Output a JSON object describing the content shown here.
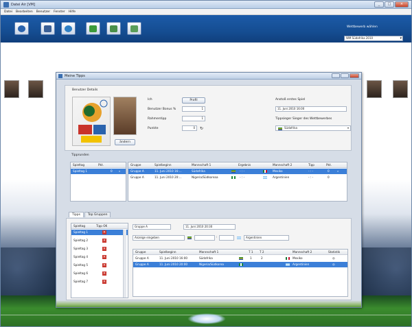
{
  "window": {
    "title": "Datei Air [VM]",
    "controls": [
      "_",
      "□",
      "×"
    ]
  },
  "menu": [
    "Datei",
    "Bearbeiten",
    "Benutzer",
    "Fenster",
    "Hilfe"
  ],
  "toolbar": {
    "season_label": "Wettbewerb wählen",
    "season_value": "WM Südafrika 2010"
  },
  "dialog": {
    "title": "Meine Tipps",
    "controls": [
      "_",
      "□",
      "×"
    ],
    "user_section": {
      "title": "Benutzer Details",
      "name_label": "Ich",
      "profile_button": "Profil",
      "bonus_label": "Benutzer Bonus %",
      "bonus_value": "1",
      "bet_label": "Rahmentipp",
      "bet_value": "1",
      "points_label": "Punkte",
      "points_value": "0",
      "change_button": "ändern"
    },
    "match_info": {
      "title": "Anstoß erstes Spiel",
      "datetime": "11. Juni 2010 16:00",
      "winner_label": "Tippsieger Sieger des Wettbewerbes",
      "winner_value": "Südafrika"
    },
    "rounds": {
      "title": "Tipprunden",
      "headers": [
        "Spieltag",
        "Pkt."
      ],
      "rows": [
        {
          "day": "Spieltag 1",
          "pts": "0"
        }
      ]
    },
    "matches_top": {
      "headers": [
        "Gruppe",
        "Spielbeginn",
        "Mannschaft 1",
        "",
        "Ergebnis",
        "Mannschaft 2",
        "Tipp",
        "Pkt."
      ],
      "rows": [
        {
          "group": "Gruppe A",
          "start": "11. Juni 2010 16:...",
          "team1": "Südafrika",
          "score": "- : -",
          "team2": "Mexiko",
          "tip": "- : -",
          "pts": "0"
        },
        {
          "group": "Gruppe A",
          "start": "11. Juni 2010 20:...",
          "team1": "Nigeria/Südkoreaa",
          "score": "- : -",
          "team2": "Argentinien",
          "tip": "- : -",
          "pts": "0"
        }
      ]
    },
    "tabs": [
      "Tipps",
      "Top Gruppen"
    ],
    "tips_list": {
      "headers": [
        "Spieltag",
        "Tipp OK"
      ],
      "rows": [
        "Spieltag 1",
        "Spieltag 2",
        "Spieltag 3",
        "Spieltag 4",
        "Spieltag 5",
        "Spieltag 6",
        "Spieltag 7"
      ]
    },
    "tip_entry": {
      "group": "Gruppe A",
      "datetime": "11. Juni 2010 20:30",
      "team1_label": "Anzeige eingeben",
      "team2": "Argentinien"
    },
    "matches_bottom": {
      "headers": [
        "Gruppe",
        "Spielbeginn",
        "Mannschaft 1",
        "",
        "T 1",
        "T 2",
        "Mannschaft 2",
        "Statistik"
      ],
      "rows": [
        {
          "group": "Gruppe A",
          "start": "11. Juni 2010 16:00",
          "team1": "Südafrika",
          "t1": "1",
          "t2": "2",
          "team2": "Mexiko"
        },
        {
          "group": "Gruppe A",
          "start": "11. Juni 2010 20:00",
          "team1": "Nigeria/Südkorea",
          "t1": "",
          "t2": "",
          "team2": "Argentinien"
        }
      ]
    }
  },
  "colors": {
    "toolbar": "#154d92",
    "selection": "#3b7fd8",
    "dialog_bg": "#d6dde7"
  }
}
